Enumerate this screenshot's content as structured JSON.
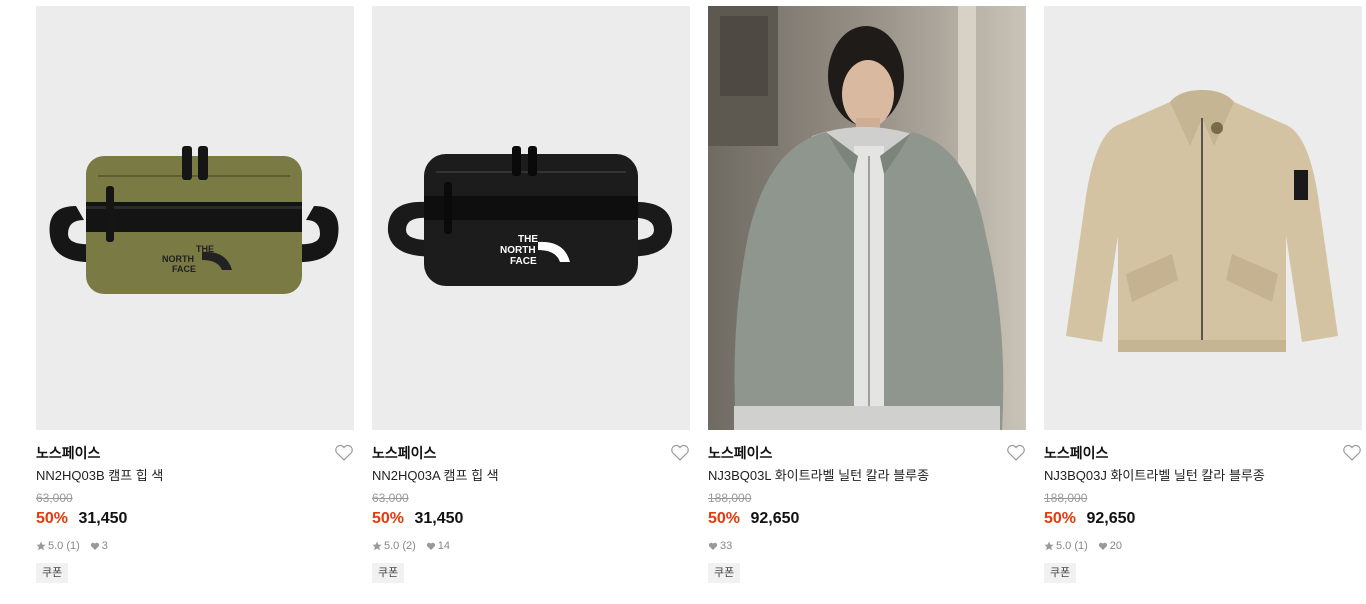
{
  "products": [
    {
      "image_icon": "hip-bag-olive-icon",
      "brand": "노스페이스",
      "name": "NN2HQ03B 캠프 힙 색",
      "original_price": "63,000",
      "discount": "50%",
      "price": "31,450",
      "rating": "5.0 (1)",
      "likes": "3",
      "coupon": "쿠폰",
      "logo_text": [
        "THE",
        "NORTH",
        "FACE"
      ]
    },
    {
      "image_icon": "hip-bag-black-icon",
      "brand": "노스페이스",
      "name": "NN2HQ03A 캠프 힙 색",
      "original_price": "63,000",
      "discount": "50%",
      "price": "31,450",
      "rating": "5.0 (2)",
      "likes": "14",
      "coupon": "쿠폰",
      "logo_text": [
        "THE",
        "NORTH",
        "FACE"
      ]
    },
    {
      "image_icon": "model-wearing-jacket-photo-icon",
      "brand": "노스페이스",
      "name": "NJ3BQ03L 화이트라벨 닐턴 칼라 블루종",
      "original_price": "188,000",
      "discount": "50%",
      "price": "92,650",
      "likes": "33",
      "coupon": "쿠폰"
    },
    {
      "image_icon": "beige-jacket-icon",
      "brand": "노스페이스",
      "name": "NJ3BQ03J 화이트라벨 닐턴 칼라 블루종",
      "original_price": "188,000",
      "discount": "50%",
      "price": "92,650",
      "rating": "5.0 (1)",
      "likes": "20",
      "coupon": "쿠폰"
    }
  ],
  "colors": {
    "discount": "#e8380d",
    "thumb_bg": "#ececec",
    "olive_bag": "#7a7a45",
    "black_bag": "#1a1a1a",
    "grey_jacket": "#8e968e",
    "beige_jacket": "#d3c3a3"
  }
}
